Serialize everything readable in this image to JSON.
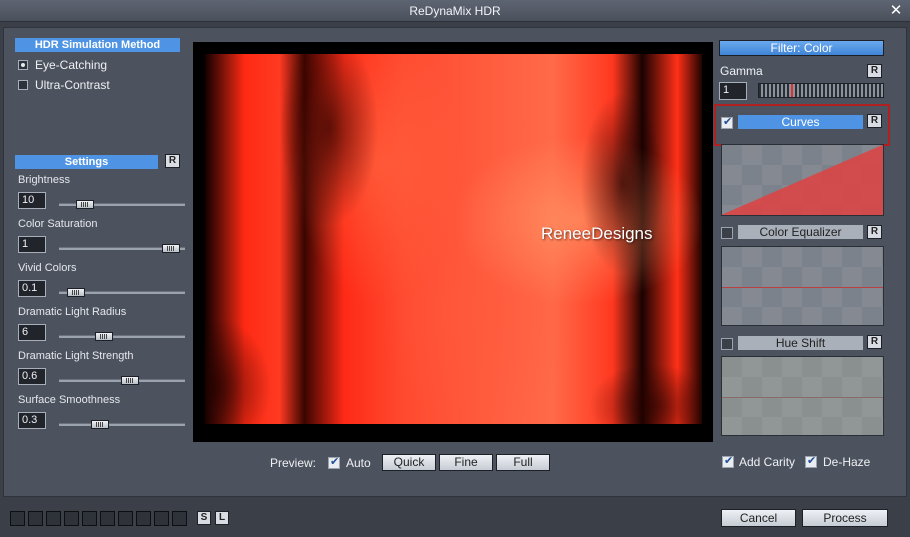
{
  "window": {
    "title": "ReDynaMix HDR",
    "close_glyph": "✕"
  },
  "hdr": {
    "header": "HDR Simulation Method",
    "options": [
      {
        "label": "Eye-Catching",
        "selected": true
      },
      {
        "label": "Ultra-Contrast",
        "selected": false
      }
    ]
  },
  "settings": {
    "header": "Settings",
    "reset_label": "R",
    "items": [
      {
        "label": "Brightness",
        "value": "10",
        "slider_fraction": 0.16
      },
      {
        "label": "Color Saturation",
        "value": "1",
        "slider_fraction": 0.95
      },
      {
        "label": "Vivid Colors",
        "value": "0.1",
        "slider_fraction": 0.07
      },
      {
        "label": "Dramatic Light Radius",
        "value": "6",
        "slider_fraction": 0.33
      },
      {
        "label": "Dramatic Light Strength",
        "value": "0.6",
        "slider_fraction": 0.57
      },
      {
        "label": "Surface Smoothness",
        "value": "0.3",
        "slider_fraction": 0.3
      }
    ]
  },
  "preview": {
    "watermark": "ReneeDesigns",
    "label": "Preview:",
    "auto_label": "Auto",
    "auto_checked": true,
    "buttons": [
      "Quick",
      "Fine",
      "Full"
    ]
  },
  "filter": {
    "title": "Filter: Color",
    "gamma_label": "Gamma",
    "gamma_value": "1",
    "reset_label": "R",
    "curves": {
      "label": "Curves",
      "checked": true
    },
    "color_equalizer": {
      "label": "Color Equalizer",
      "checked": false
    },
    "hue_shift": {
      "label": "Hue Shift",
      "checked": false
    },
    "add_carity": {
      "label": "Add Carity",
      "checked": true
    },
    "de_haze": {
      "label": "De-Haze",
      "checked": true
    }
  },
  "footer": {
    "s_label": "S",
    "l_label": "L",
    "cancel_label": "Cancel",
    "process_label": "Process"
  },
  "colors": {
    "accent": "#4f94e4",
    "highlight": "#b02020",
    "panel": "#4d535e"
  }
}
